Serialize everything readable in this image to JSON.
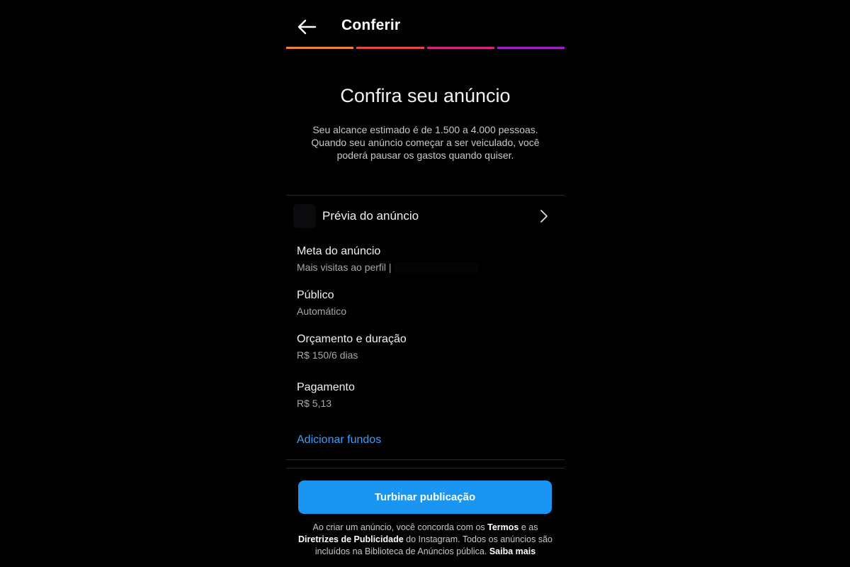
{
  "header": {
    "title": "Conferir",
    "back_icon": "arrow-left-icon"
  },
  "progress": {
    "colors": [
      "#f0833a",
      "#e04a3f",
      "#d2247a",
      "#a020c8"
    ]
  },
  "main": {
    "heading": "Confira seu anúncio",
    "description_line1": "Seu alcance estimado é de 1.500 a 4.000 pessoas.",
    "description_line2": "Quando seu anúncio começar a ser veiculado, você",
    "description_line3": "poderá pausar os gastos quando quiser."
  },
  "preview": {
    "label": "Prévia do anúncio",
    "chevron_icon": "chevron-right-icon"
  },
  "settings": {
    "goal_label": "Meta do anúncio",
    "goal_value": "Mais visitas ao perfil |",
    "audience_label": "Público",
    "audience_value": "Automático",
    "budget_label": "Orçamento e duração",
    "budget_value": "R$ 150/6 dias",
    "payment_label": "Pagamento",
    "payment_value": "R$ 5,13",
    "add_funds": "Adicionar fundos"
  },
  "footer": {
    "cta_label": "Turbinar publicação",
    "legal_part1": "Ao criar um anúncio, você concorda com os",
    "terms_link": "Termos",
    "legal_part2": "e as",
    "guidelines_link": "Diretrizes de Publicidade",
    "legal_part3": "do Instagram. Todos os anúncios são incluídos na Biblioteca de Anúncios pública.",
    "learn_more_link": "Saiba mais"
  },
  "colors": {
    "accent": "#1b95f2",
    "link": "#3d9ef5",
    "background": "#000000"
  }
}
